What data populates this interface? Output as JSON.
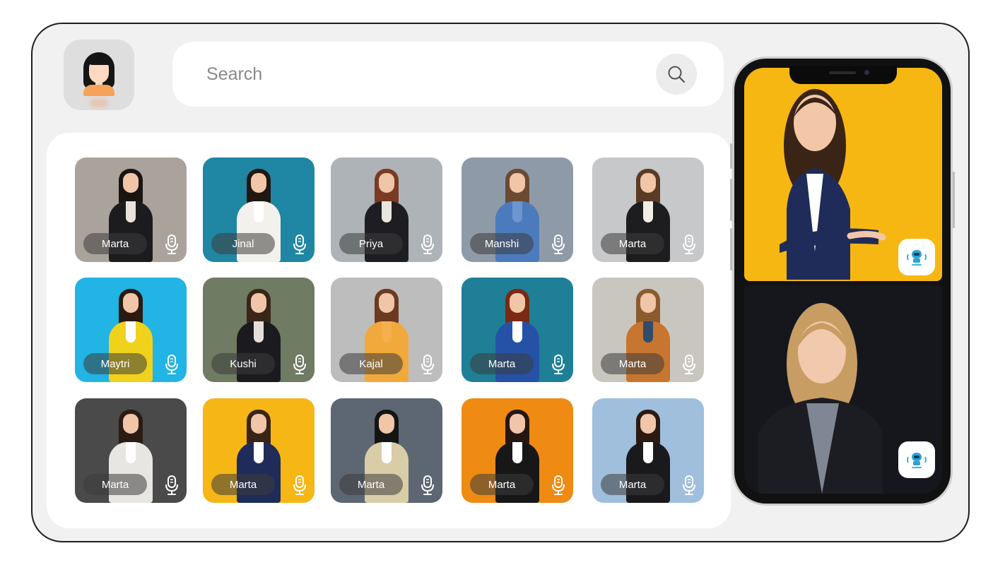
{
  "search": {
    "placeholder": "Search"
  },
  "profiles": [
    {
      "name": "Marta",
      "bg": "#a9a39b",
      "hair": "#1a1412",
      "outfit": "#1c1c1f",
      "shirt": "#e8e2da"
    },
    {
      "name": "Jinal",
      "bg": "#1f86a3",
      "hair": "#1f1712",
      "outfit": "#f3f1ec",
      "shirt": "#ffffff"
    },
    {
      "name": "Priya",
      "bg": "#aeb3b7",
      "hair": "#7a3b22",
      "outfit": "#1e1e22",
      "shirt": "#e9e5df"
    },
    {
      "name": "Manshi",
      "bg": "#8f9aa8",
      "hair": "#6b4a33",
      "outfit": "#4c7bbd",
      "shirt": "#6d95cf"
    },
    {
      "name": "Marta",
      "bg": "#c7c8ca",
      "hair": "#5a3b26",
      "outfit": "#1d1d20",
      "shirt": "#f1ece6"
    },
    {
      "name": "Maytri",
      "bg": "#21b4e4",
      "hair": "#2a1a12",
      "outfit": "#f0d21d",
      "shirt": "#ffffff"
    },
    {
      "name": "Kushi",
      "bg": "#6f7b62",
      "hair": "#3a2618",
      "outfit": "#1b1b1f",
      "shirt": "#e4ded6"
    },
    {
      "name": "Kajal",
      "bg": "#bdbdbd",
      "hair": "#6b3a20",
      "outfit": "#f2a93b",
      "shirt": "#f4b04c"
    },
    {
      "name": "Marta",
      "bg": "#1f7f97",
      "hair": "#7a2a12",
      "outfit": "#2552a6",
      "shirt": "#ffffff"
    },
    {
      "name": "Marta",
      "bg": "#c9c6bf",
      "hair": "#8b5b2e",
      "outfit": "#c8752f",
      "shirt": "#2f4c6b"
    },
    {
      "name": "Marta",
      "bg": "#4a4a4a",
      "hair": "#2a1c14",
      "outfit": "#e8e6e2",
      "shirt": "#ffffff"
    },
    {
      "name": "Marta",
      "bg": "#f6b616",
      "hair": "#3a2416",
      "outfit": "#1f2c59",
      "shirt": "#ffffff"
    },
    {
      "name": "Marta",
      "bg": "#5d6673",
      "hair": "#141414",
      "outfit": "#d9cda8",
      "shirt": "#ffffff"
    },
    {
      "name": "Marta",
      "bg": "#ef8a12",
      "hair": "#241711",
      "outfit": "#171717",
      "shirt": "#ffffff"
    },
    {
      "name": "Marta",
      "bg": "#9fbfdc",
      "hair": "#2a1a12",
      "outfit": "#1a1a1d",
      "shirt": "#ffffff"
    }
  ],
  "phone": {
    "top_bg": "#f7b712",
    "bottom_bg": "#15171c",
    "icons": [
      "voice-bot-icon",
      "voice-bot-icon"
    ]
  },
  "colors": {
    "frame_bg": "#f1f1f1",
    "pill_bg": "rgba(60,60,60,0.55)",
    "accent_bot": "#2aa5d6"
  }
}
